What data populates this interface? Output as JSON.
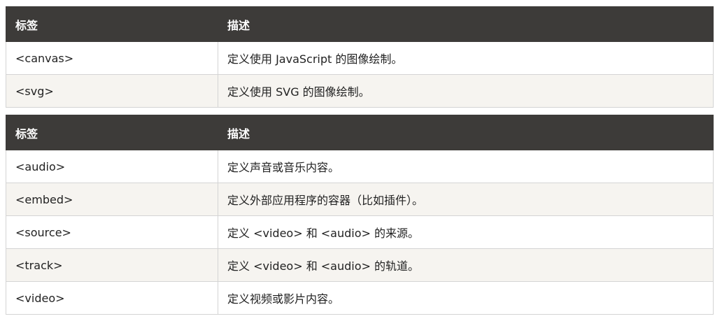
{
  "table1": {
    "headers": [
      "标签",
      "描述"
    ],
    "rows": [
      [
        "<canvas>",
        "定义使用 JavaScript 的图像绘制。"
      ],
      [
        "<svg>",
        "定义使用 SVG 的图像绘制。"
      ]
    ]
  },
  "table2": {
    "headers": [
      "标签",
      "描述"
    ],
    "rows": [
      [
        "<audio>",
        "定义声音或音乐内容。"
      ],
      [
        "<embed>",
        "定义外部应用程序的容器（比如插件）。"
      ],
      [
        "<source>",
        "定义 <video> 和 <audio> 的来源。"
      ],
      [
        "<track>",
        "定义 <video> 和 <audio> 的轨道。"
      ],
      [
        "<video>",
        "定义视频或影片内容。"
      ]
    ]
  },
  "colors": {
    "header_bg": "#3d3b39",
    "header_text": "#ffffff",
    "row_alt_bg": "#f6f4f0",
    "border": "#d4d4d4"
  }
}
